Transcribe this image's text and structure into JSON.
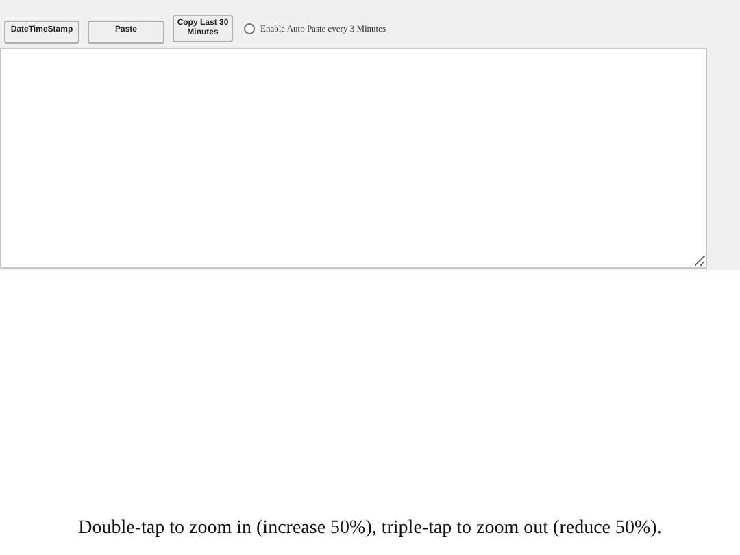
{
  "toolbar": {
    "buttons": [
      {
        "label": "DateTimeStamp"
      },
      {
        "label": "Paste"
      },
      {
        "label": "Copy Last 30 Minutes"
      }
    ],
    "auto_paste": {
      "label": "Enable Auto Paste every 3 Minutes",
      "checked": false
    }
  },
  "footer": {
    "hint": "Double-tap to zoom in (increase 50%), triple-tap to zoom out (reduce 50%)."
  }
}
